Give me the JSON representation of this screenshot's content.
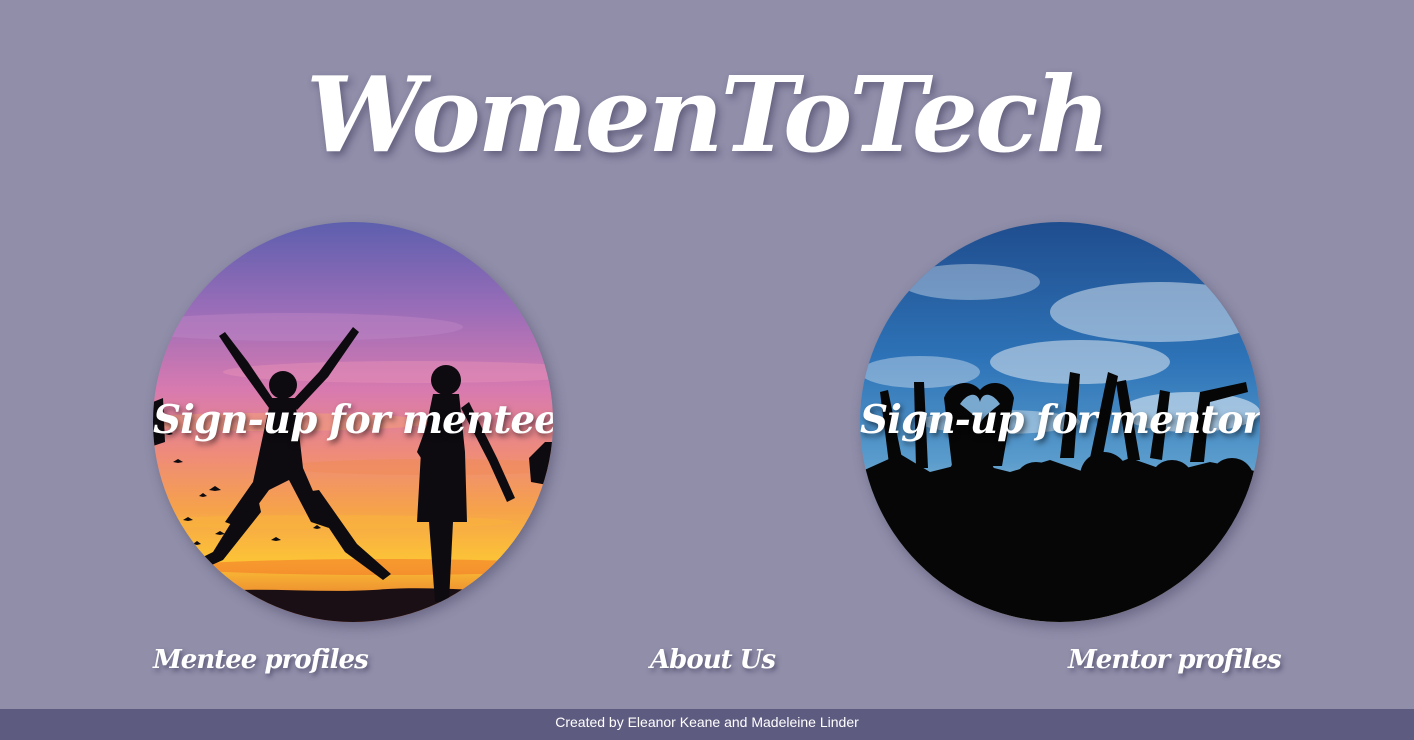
{
  "header": {
    "title": "WomenToTech"
  },
  "signup": {
    "mentees_label": "Sign-up for mentees",
    "mentors_label": "Sign-up for mentors"
  },
  "nav": {
    "mentee_profiles": "Mentee profiles",
    "about_us": "About Us",
    "mentor_profiles": "Mentor profiles"
  },
  "footer": {
    "credit": "Created by Eleanor Keane and Madeleine Linder"
  },
  "colors": {
    "background": "#908ea9",
    "footer_background": "#5e5b80",
    "text": "#ffffff"
  }
}
